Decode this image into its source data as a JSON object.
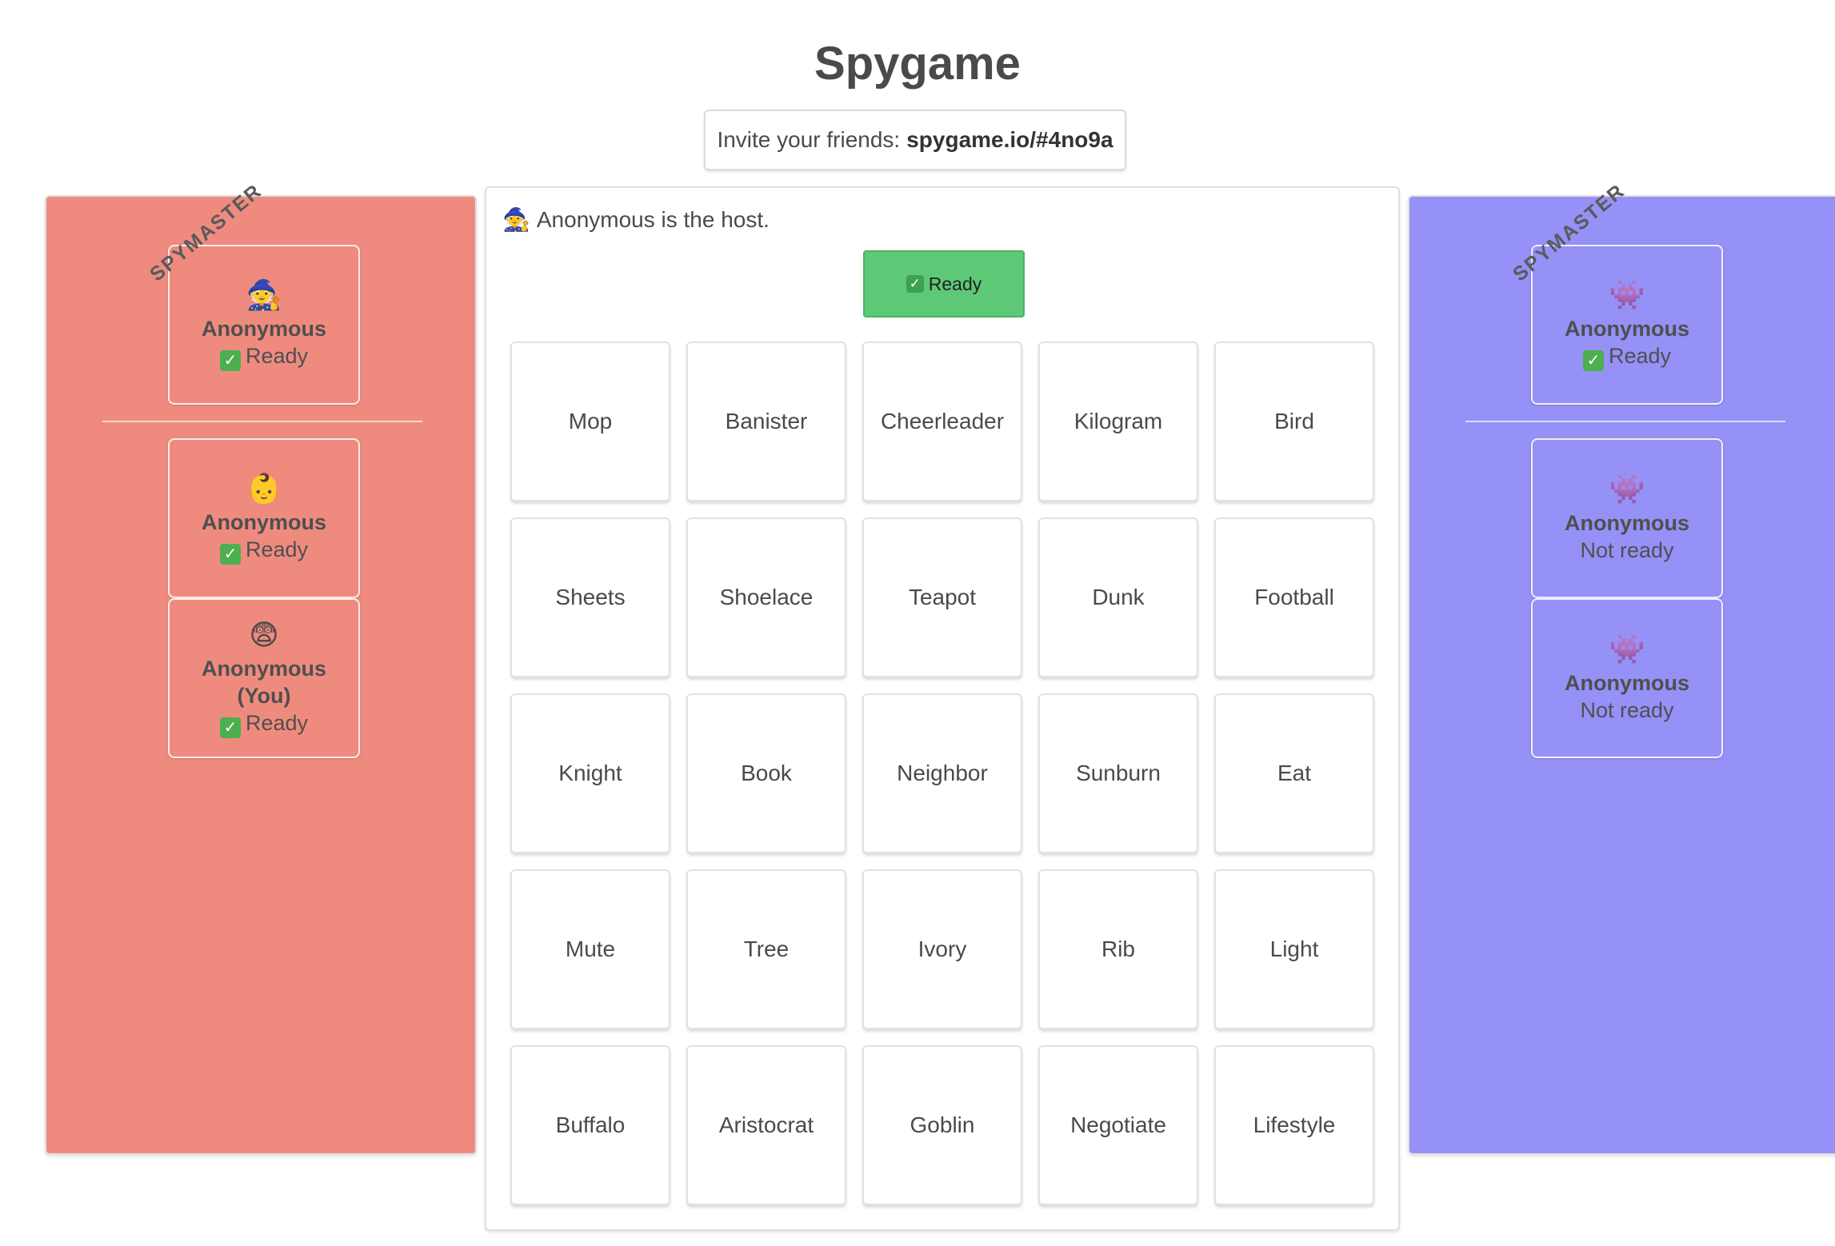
{
  "header": {
    "title": "Spygame",
    "invite_label": "Invite your friends:",
    "invite_link": "spygame.io/#4no9a"
  },
  "colors": {
    "red_team": "#ef8b7e",
    "blue_team": "#9591f7",
    "ready_button": "#5dc977"
  },
  "red_team": {
    "spymaster_tag": "SPYMASTER",
    "spymaster": {
      "emoji": "🧙",
      "name": "Anonymous",
      "status": "Ready",
      "ready": true
    },
    "players": [
      {
        "emoji": "👶",
        "name": "Anonymous",
        "status": "Ready",
        "ready": true
      },
      {
        "emoji": "😨",
        "name": "Anonymous",
        "you": "(You)",
        "status": "Ready",
        "ready": true
      }
    ]
  },
  "blue_team": {
    "spymaster_tag": "SPYMASTER",
    "spymaster": {
      "emoji": "👾",
      "name": "Anonymous",
      "status": "Ready",
      "ready": true
    },
    "players": [
      {
        "emoji": "👾",
        "name": "Anonymous",
        "status": "Not ready",
        "ready": false
      },
      {
        "emoji": "👾",
        "name": "Anonymous",
        "status": "Not ready",
        "ready": false
      }
    ]
  },
  "board": {
    "host_emoji": "🧙",
    "host_text": "Anonymous is the host.",
    "ready_button_label": "Ready",
    "words": [
      "Mop",
      "Banister",
      "Cheerleader",
      "Kilogram",
      "Bird",
      "Sheets",
      "Shoelace",
      "Teapot",
      "Dunk",
      "Football",
      "Knight",
      "Book",
      "Neighbor",
      "Sunburn",
      "Eat",
      "Mute",
      "Tree",
      "Ivory",
      "Rib",
      "Light",
      "Buffalo",
      "Aristocrat",
      "Goblin",
      "Negotiate",
      "Lifestyle"
    ]
  }
}
